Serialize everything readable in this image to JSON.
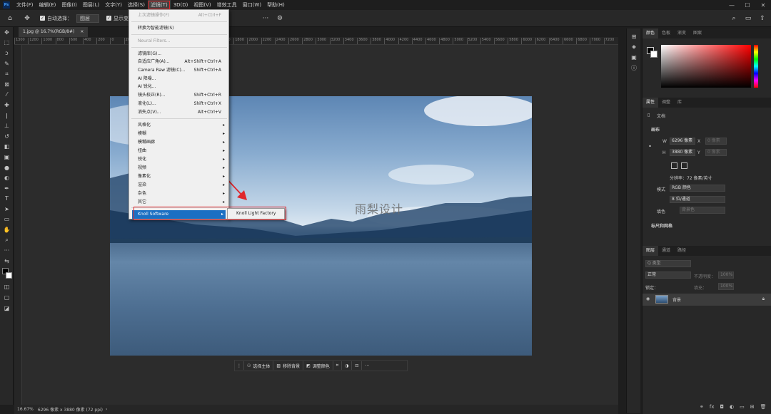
{
  "menubar": {
    "items": [
      "文件(F)",
      "编辑(E)",
      "图像(I)",
      "图层(L)",
      "文字(Y)",
      "选择(S)",
      "滤镜(T)",
      "3D(D)",
      "视图(V)",
      "增效工具",
      "窗口(W)",
      "帮助(H)"
    ],
    "logo": "Ps"
  },
  "options": {
    "auto_select_label": "自动选择：",
    "auto_select_value": "图层",
    "show_transform_label": "显示变"
  },
  "document_tab": {
    "title": "1.jpg @ 16.7%(RGB/8#)",
    "close": "×"
  },
  "ruler_ticks": [
    "1300",
    "1200",
    "1000",
    "800",
    "600",
    "400",
    "200",
    "0",
    "200",
    "400",
    "600",
    "800",
    "1000",
    "1200",
    "1400",
    "1600",
    "1800",
    "2000",
    "2200",
    "2400",
    "2600",
    "2800",
    "3000",
    "3200",
    "3400",
    "3600",
    "3800",
    "4000",
    "4200",
    "4400",
    "4600",
    "4800",
    "5000",
    "5200",
    "5400",
    "5600",
    "5800",
    "6000",
    "6200",
    "6400",
    "6600",
    "6800",
    "7000",
    "7200"
  ],
  "filter_menu": {
    "items": [
      {
        "label": "上次滤镜操作(F)",
        "shortcut": "Alt+Ctrl+F",
        "dim": true
      },
      {
        "label": "转换为智能滤镜(S)"
      },
      {
        "label": "Neural Filters...",
        "dim": true
      },
      {
        "label": "滤镜库(G)..."
      },
      {
        "label": "自适应广角(A)...",
        "shortcut": "Alt+Shift+Ctrl+A"
      },
      {
        "label": "Camera Raw 滤镜(C)...",
        "shortcut": "Shift+Ctrl+A"
      },
      {
        "label": "AI 降噪..."
      },
      {
        "label": "AI 锐化..."
      },
      {
        "label": "镜头校正(R)...",
        "shortcut": "Shift+Ctrl+R"
      },
      {
        "label": "液化(L)...",
        "shortcut": "Shift+Ctrl+X"
      },
      {
        "label": "消失点(V)...",
        "shortcut": "Alt+Ctrl+V"
      },
      {
        "label": "风格化",
        "sub": true
      },
      {
        "label": "模糊",
        "sub": true
      },
      {
        "label": "模糊画廊",
        "sub": true
      },
      {
        "label": "扭曲",
        "sub": true
      },
      {
        "label": "锐化",
        "sub": true
      },
      {
        "label": "视频",
        "sub": true
      },
      {
        "label": "像素化",
        "sub": true
      },
      {
        "label": "渲染",
        "sub": true
      },
      {
        "label": "杂色",
        "sub": true
      },
      {
        "label": "其它",
        "sub": true
      },
      {
        "label": "Knoll Software",
        "sub": true,
        "selected": true
      }
    ],
    "submenu_item": "Knoll Light Factory"
  },
  "image": {
    "watermark": "雨梨设计"
  },
  "bottom_bar": {
    "select_subject": "选择主体",
    "remove_bg": "移除背景",
    "adjust_color": "调整颜色",
    "more": "···"
  },
  "status": {
    "zoom": "16.67%",
    "size": "6296 像素 x 3880 像素 (72 ppi)"
  },
  "panels": {
    "color_tabs": [
      "颜色",
      "色板",
      "渐变",
      "图案"
    ],
    "prop_tabs": [
      "属性",
      "调整",
      "库"
    ],
    "doc_label": "文档",
    "canvas_title": "画布",
    "w_label": "W",
    "w_value": "6296 像素",
    "x_label": "X",
    "x_placeholder": "0 像素",
    "h_label": "H",
    "h_value": "3880 像素",
    "y_label": "Y",
    "y_placeholder": "0 像素",
    "resolution": "分辨率：72 像素/英寸",
    "mode_label": "模式",
    "mode_value": "RGB 颜色",
    "bits_value": "8 位/通道",
    "fill_label": "填色",
    "fill_value": "背景色",
    "rulers_title": "标尺和网格",
    "layer_tabs": [
      "图层",
      "通道",
      "路径"
    ],
    "kind": "Q 类型",
    "blend": "正常",
    "opacity_label": "不透明度：",
    "opacity": "100%",
    "lock_label": "锁定：",
    "fill2_label": "填充：",
    "fill2": "100%",
    "layer_name": "背景"
  },
  "colors": {
    "accent": "#e0262b",
    "select": "#1b6fc3"
  }
}
